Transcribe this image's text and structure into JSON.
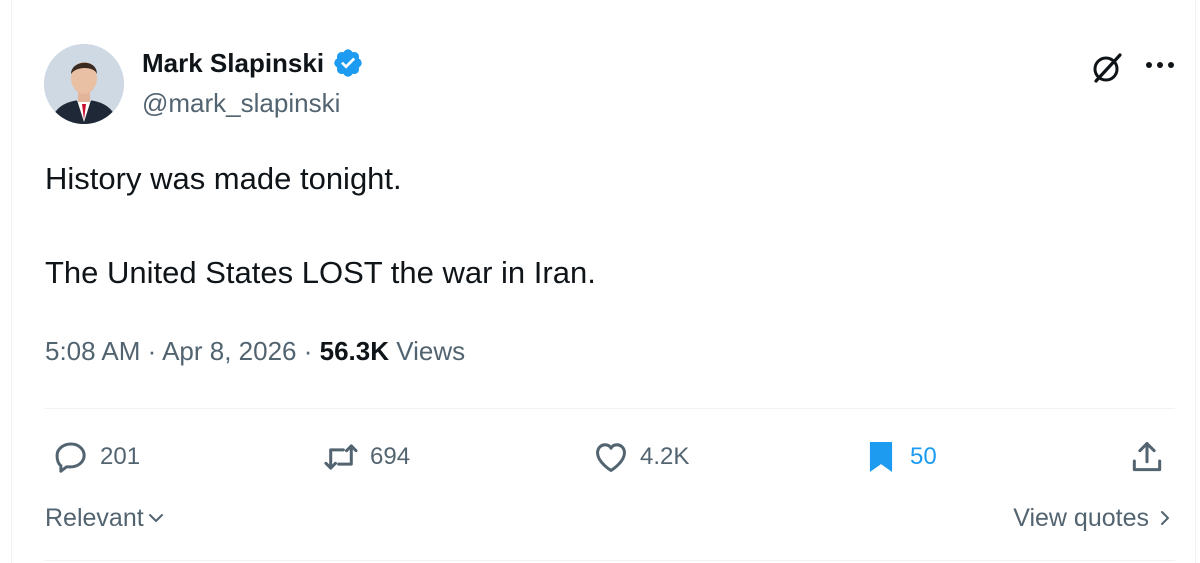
{
  "user": {
    "display_name": "Mark Slapinski",
    "handle": "@mark_slapinski",
    "verified_icon": "verified-badge-icon"
  },
  "tweet": {
    "line1": "History was made tonight.",
    "line2": "The United States LOST the war in Iran.",
    "time": "5:08 AM",
    "date": "Apr 8, 2026",
    "views_count": "56.3K",
    "views_label": "Views"
  },
  "actions": {
    "replies": "201",
    "reposts": "694",
    "likes": "4.2K",
    "bookmarks": "50"
  },
  "footer": {
    "sort_label": "Relevant",
    "quotes_link": "View quotes"
  },
  "colors": {
    "accent": "#1d9bf0",
    "text_primary": "#0f1419",
    "text_secondary": "#536471",
    "divider": "#eff3f4"
  }
}
